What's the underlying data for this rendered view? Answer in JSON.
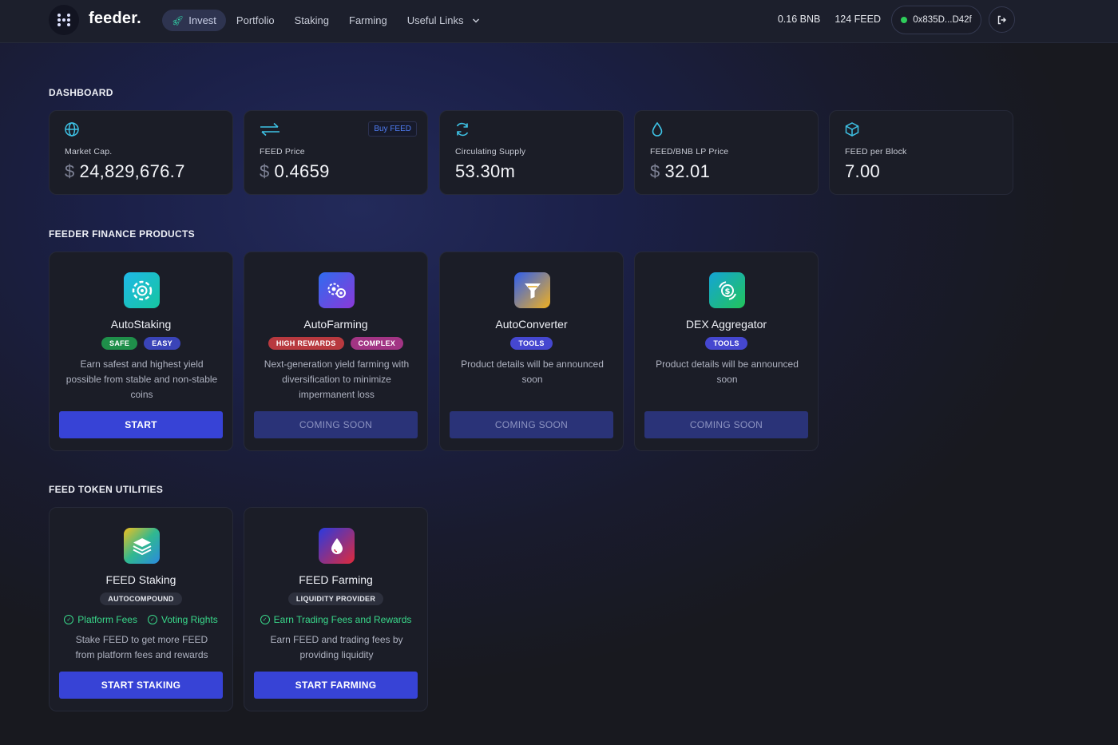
{
  "header": {
    "brand": "feeder.",
    "nav": [
      {
        "label": "Invest",
        "active": true
      },
      {
        "label": "Portfolio"
      },
      {
        "label": "Staking"
      },
      {
        "label": "Farming"
      },
      {
        "label": "Useful Links",
        "dropdown": true
      }
    ],
    "bnb_balance": "0.16 BNB",
    "feed_balance": "124 FEED",
    "wallet_address": "0x835D...D42f",
    "wallet_status_color": "#2ecc5a"
  },
  "dashboard": {
    "title": "DASHBOARD",
    "cards": [
      {
        "icon": "globe-icon",
        "label": "Market Cap.",
        "currency": "$",
        "value": "24,829,676.7"
      },
      {
        "icon": "swap-arrows-icon",
        "label": "FEED Price",
        "currency": "$",
        "value": "0.4659",
        "badge": "Buy FEED"
      },
      {
        "icon": "refresh-icon",
        "label": "Circulating Supply",
        "currency": "",
        "value": "53.30m"
      },
      {
        "icon": "droplet-icon",
        "label": "FEED/BNB LP Price",
        "currency": "$",
        "value": "32.01"
      },
      {
        "icon": "cube-icon",
        "label": "FEED per Block",
        "currency": "",
        "value": "7.00"
      }
    ]
  },
  "products": {
    "title": "FEEDER FINANCE PRODUCTS",
    "items": [
      {
        "name": "AutoStaking",
        "tags": [
          "SAFE",
          "EASY"
        ],
        "description": "Earn safest and highest yield possible from stable and non-stable coins",
        "button": "START"
      },
      {
        "name": "AutoFarming",
        "tags": [
          "HIGH REWARDS",
          "COMPLEX"
        ],
        "description": "Next-generation yield farming with diversification to minimize impermanent loss",
        "button": "COMING SOON"
      },
      {
        "name": "AutoConverter",
        "tags": [
          "TOOLS"
        ],
        "description": "Product details will be announced soon",
        "button": "COMING SOON"
      },
      {
        "name": "DEX Aggregator",
        "tags": [
          "TOOLS"
        ],
        "description": "Product details will be announced soon",
        "button": "COMING SOON"
      }
    ]
  },
  "utilities": {
    "title": "FEED TOKEN UTILITIES",
    "items": [
      {
        "name": "FEED Staking",
        "tag": "AUTOCOMPOUND",
        "checks": [
          "Platform Fees",
          "Voting Rights"
        ],
        "description": "Stake FEED to get more FEED from platform fees and rewards",
        "button": "START STAKING"
      },
      {
        "name": "FEED Farming",
        "tag": "LIQUIDITY PROVIDER",
        "checks": [
          "Earn Trading Fees and Rewards"
        ],
        "description": "Earn FEED and trading fees by providing liquidity",
        "button": "START FARMING"
      }
    ]
  },
  "colors": {
    "accent": "#3743d6",
    "accent_disabled": "#2a3378",
    "check_green": "#39d88a",
    "icon_cyan": "#3ec3e6"
  }
}
